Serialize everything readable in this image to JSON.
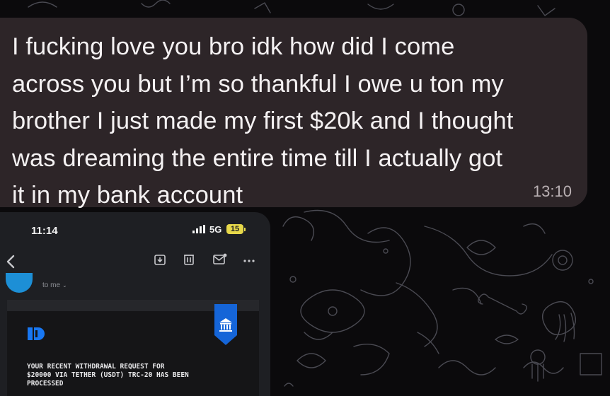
{
  "message": {
    "text": "I fucking love you bro idk how did I come\nacross you but I’m so thankful I owe u ton my\nbrother I just made my first $20k and I thought\nwas dreaming the entire time till I actually got\nit in my bank account",
    "time": "13:10",
    "bubble_color": "#2d2528"
  },
  "screenshot": {
    "status_time": "11:14",
    "network": "5G",
    "battery": "15",
    "to_label": "to me",
    "notice": "YOUR RECENT WITHDRAWAL REQUEST FOR\n$20000 VIA TETHER (USDT) TRC-20 HAS BEEN\nPROCESSED",
    "icons": [
      "back-icon",
      "archive-icon",
      "trash-icon",
      "mark-unread-icon",
      "more-icon"
    ],
    "colors": {
      "avatar": "#1d8fd6",
      "badge": "#1565d8",
      "brand": "#1877f2"
    }
  }
}
